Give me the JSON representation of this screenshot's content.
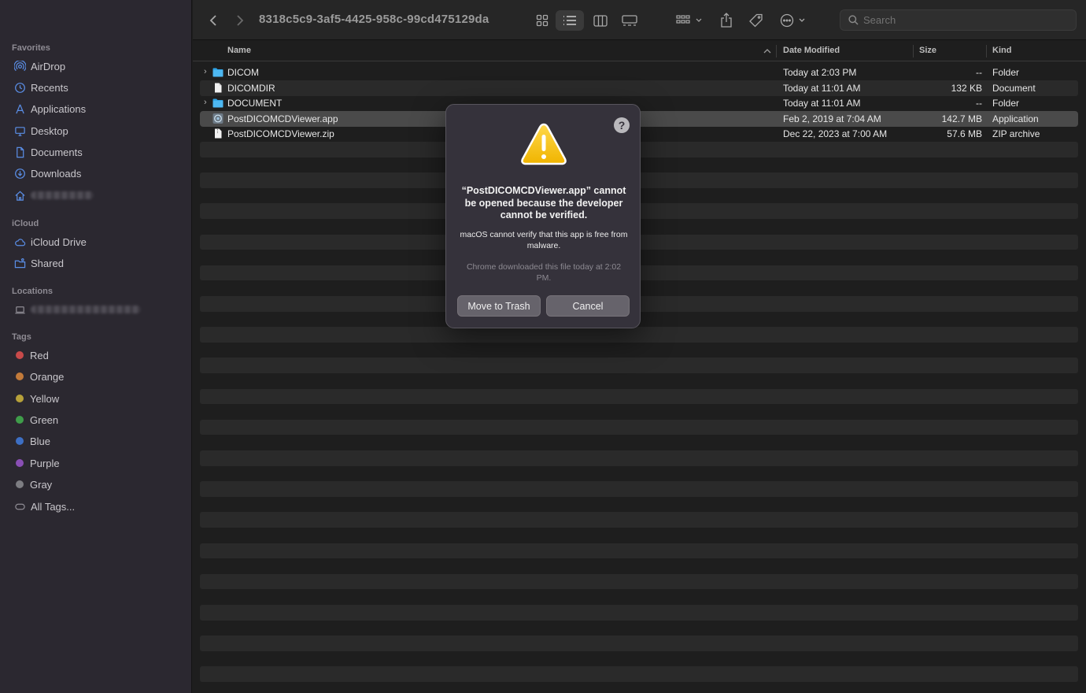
{
  "sidebar": {
    "favorites_title": "Favorites",
    "favorites": [
      {
        "label": "AirDrop",
        "icon": "airdrop-icon"
      },
      {
        "label": "Recents",
        "icon": "clock-icon"
      },
      {
        "label": "Applications",
        "icon": "applications-icon"
      },
      {
        "label": "Desktop",
        "icon": "desktop-icon"
      },
      {
        "label": "Documents",
        "icon": "document-icon"
      },
      {
        "label": "Downloads",
        "icon": "download-icon"
      }
    ],
    "icloud_title": "iCloud",
    "icloud": [
      {
        "label": "iCloud Drive",
        "icon": "cloud-icon"
      },
      {
        "label": "Shared",
        "icon": "shared-folder-icon"
      }
    ],
    "locations_title": "Locations",
    "tags_title": "Tags",
    "tags": [
      {
        "label": "Red",
        "color": "#c84a4a"
      },
      {
        "label": "Orange",
        "color": "#c27a3a"
      },
      {
        "label": "Yellow",
        "color": "#b7a13a"
      },
      {
        "label": "Green",
        "color": "#3f9d4a"
      },
      {
        "label": "Blue",
        "color": "#3d6fc4"
      },
      {
        "label": "Purple",
        "color": "#8a4fb5"
      },
      {
        "label": "Gray",
        "color": "#7d7d82"
      }
    ],
    "all_tags_label": "All Tags..."
  },
  "toolbar": {
    "title": "8318c5c9-3af5-4425-958c-99cd475129da",
    "search_placeholder": "Search"
  },
  "columns": {
    "name": "Name",
    "date": "Date Modified",
    "size": "Size",
    "kind": "Kind"
  },
  "files": [
    {
      "name": "DICOM",
      "date": "Today at 2:03 PM",
      "size": "--",
      "kind": "Folder",
      "type": "folder"
    },
    {
      "name": "DICOMDIR",
      "date": "Today at 11:01 AM",
      "size": "132 KB",
      "kind": "Document",
      "type": "file"
    },
    {
      "name": "DOCUMENT",
      "date": "Today at 11:01 AM",
      "size": "--",
      "kind": "Folder",
      "type": "folder"
    },
    {
      "name": "PostDICOMCDViewer.app",
      "date": "Feb 2, 2019 at 7:04 AM",
      "size": "142.7 MB",
      "kind": "Application",
      "type": "app"
    },
    {
      "name": "PostDICOMCDViewer.zip",
      "date": "Dec 22, 2023 at 7:00 AM",
      "size": "57.6 MB",
      "kind": "ZIP archive",
      "type": "file"
    }
  ],
  "dialog": {
    "title": "“PostDICOMCDViewer.app” cannot be opened because the developer cannot be verified.",
    "message": "macOS cannot verify that this app is free from malware.",
    "note": "Chrome downloaded this file today at 2:02 PM.",
    "help_label": "?",
    "trash_label": "Move to Trash",
    "cancel_label": "Cancel"
  }
}
